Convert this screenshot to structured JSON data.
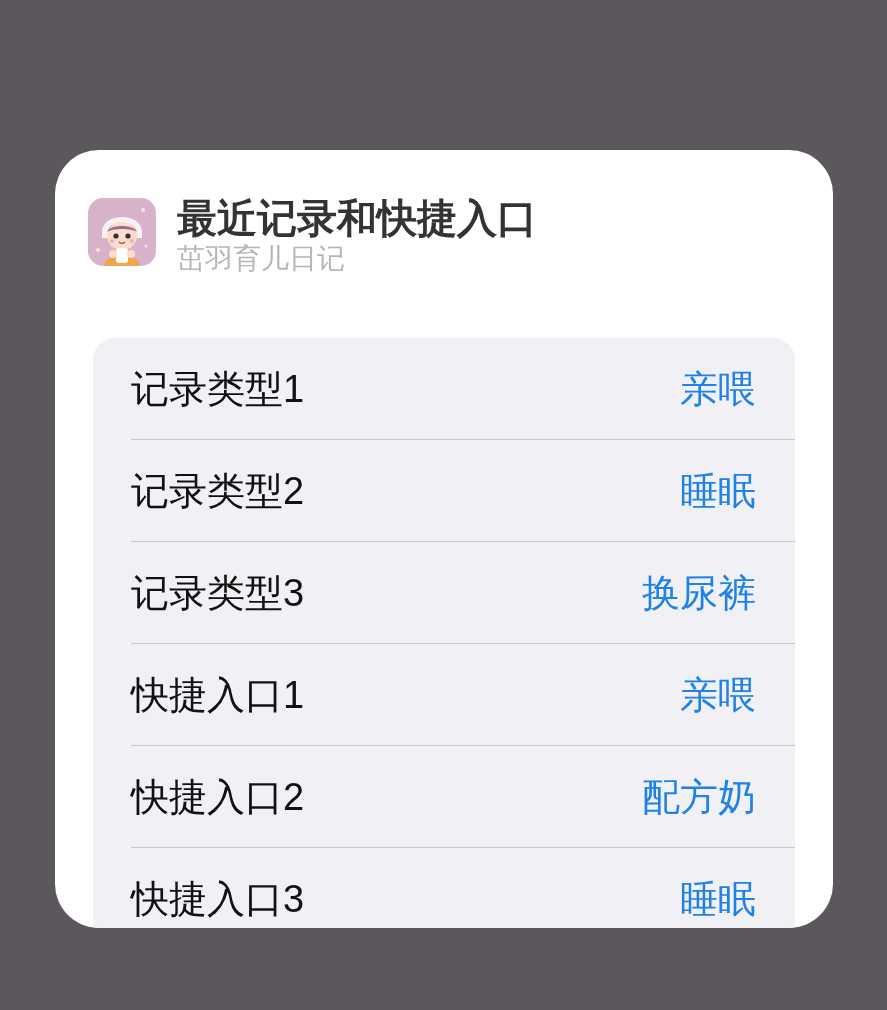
{
  "widget": {
    "title": "最近记录和快捷入口",
    "subtitle": "茁羽育儿日记"
  },
  "rows": [
    {
      "label": "记录类型1",
      "value": "亲喂"
    },
    {
      "label": "记录类型2",
      "value": "睡眠"
    },
    {
      "label": "记录类型3",
      "value": "换尿裤"
    },
    {
      "label": "快捷入口1",
      "value": "亲喂"
    },
    {
      "label": "快捷入口2",
      "value": "配方奶"
    },
    {
      "label": "快捷入口3",
      "value": "睡眠"
    }
  ]
}
